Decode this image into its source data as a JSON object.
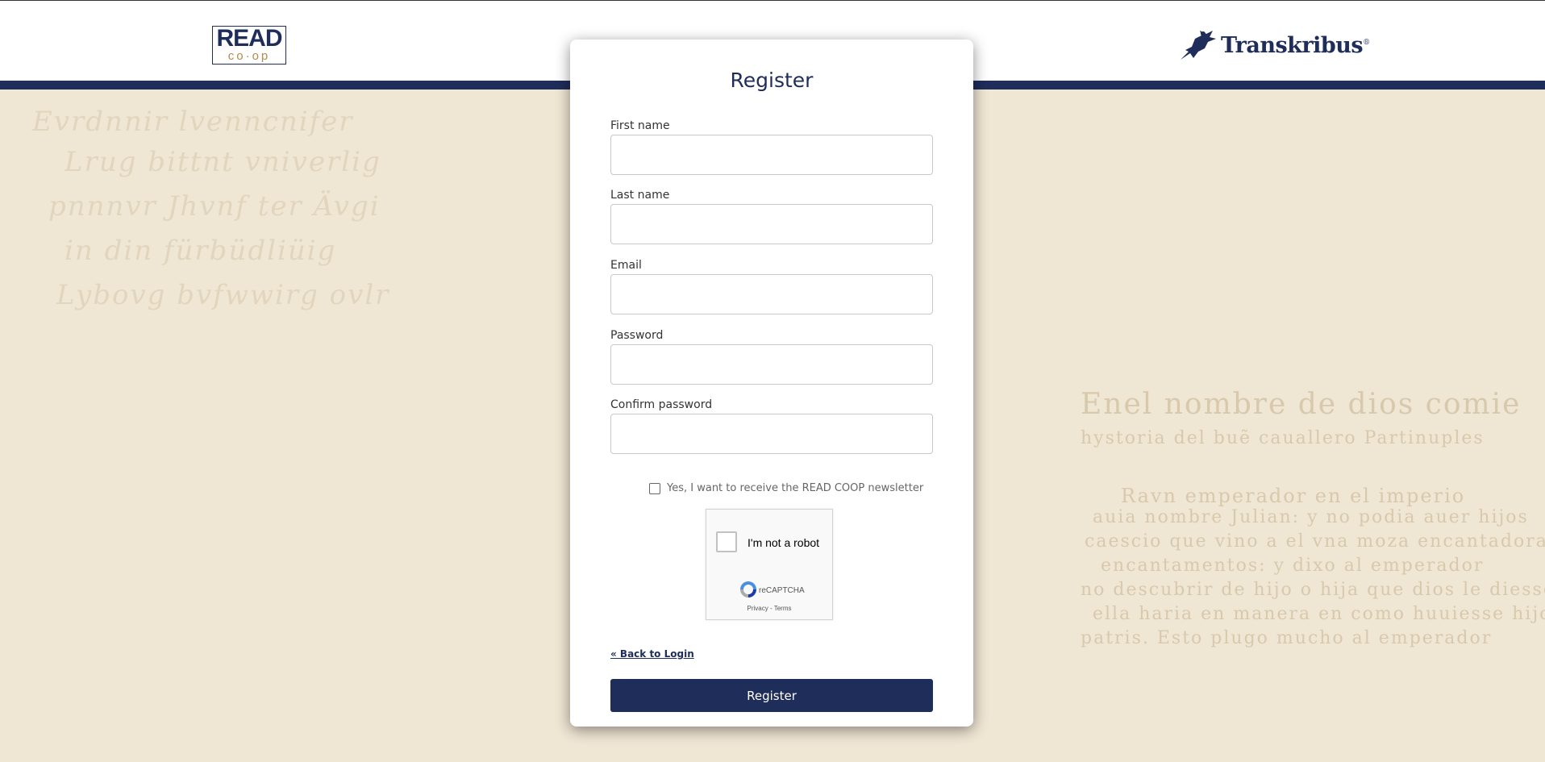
{
  "header": {
    "read_logo_top": "READ",
    "read_logo_bottom": "co·op",
    "transkribus_logo": "Transkribus",
    "transkribus_mark": "®"
  },
  "form": {
    "title": "Register",
    "fields": [
      {
        "label": "First name",
        "value": ""
      },
      {
        "label": "Last name",
        "value": ""
      },
      {
        "label": "Email",
        "value": ""
      },
      {
        "label": "Password",
        "value": ""
      },
      {
        "label": "Confirm password",
        "value": ""
      }
    ],
    "newsletter_label": "Yes, I want to receive the READ COOP newsletter",
    "newsletter_checked": false,
    "captcha": {
      "label": "I'm not a robot",
      "brand": "reCAPTCHA",
      "links": "Privacy - Terms"
    },
    "back_link": "« Back to Login",
    "submit_label": "Register"
  },
  "background_text": [
    "Evrdnnir lvenncnifer",
    "Lrug bittnt vniverlig",
    "pnnnvr Jhvnf ter Ävgi",
    "in din fürbüdliüig",
    "Lybovg bvfwwirg ovlr",
    "Enel nombre de dios comie",
    "hystoria del buẽ cauallero Partinuples",
    "Ravn emperador en el imperio",
    "auia nombre Julian: y no podia auer hijos",
    "caescio que vino a el vna moza encantadora",
    "encantamentos: y dixo al emperador",
    "no descubrir de hijo o hija que dios le diesse",
    "ella haria en manera en como huuiesse hijo",
    "patris. Esto plugo mucho al emperador"
  ],
  "colors": {
    "brand_navy": "#1e2d5a",
    "background_paper": "#f0e6d4"
  }
}
